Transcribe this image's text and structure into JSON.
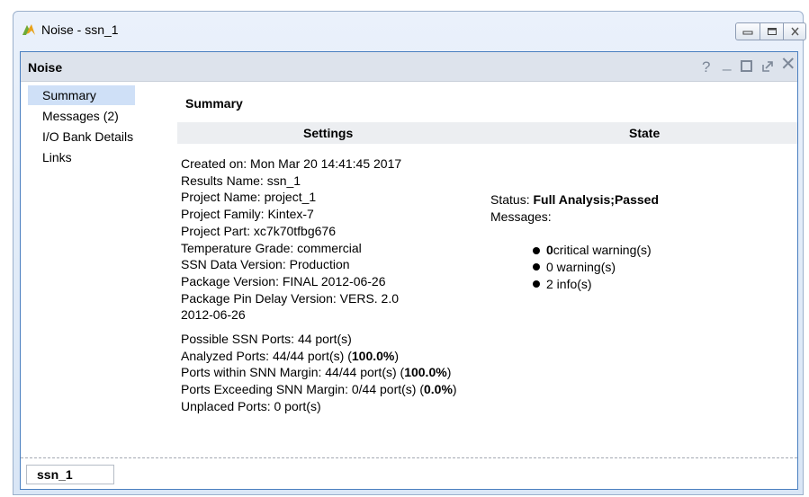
{
  "window": {
    "title": "Noise - ssn_1",
    "icon": "vivado-logo-icon",
    "controls": [
      "minimize",
      "maximize",
      "close"
    ]
  },
  "panel": {
    "title": "Noise",
    "header_controls": {
      "help": "?",
      "minimize": "_",
      "restore": "⇗",
      "close": "✕"
    }
  },
  "nav": {
    "items": [
      {
        "label": "Summary",
        "active": true
      },
      {
        "label": "Messages (2)",
        "active": false
      },
      {
        "label": "I/O Bank Details",
        "active": false
      },
      {
        "label": "Links",
        "active": false
      }
    ]
  },
  "content": {
    "title": "Summary",
    "settings_header": "Settings",
    "state_header": "State",
    "settings": {
      "created_on": "Created on: Mon Mar 20 14:41:45 2017",
      "results_name": "Results Name: ssn_1",
      "project_name": "Project Name: project_1",
      "project_family": "Project Family: Kintex-7",
      "project_part": "Project Part: xc7k70tfbg676",
      "temperature_grade": "Temperature Grade: commercial",
      "ssn_data_version": "SSN Data Version: Production",
      "package_version": "Package Version: FINAL 2012-06-26",
      "package_pin_delay_1": "Package Pin Delay Version: VERS. 2.0",
      "package_pin_delay_2": "2012-06-26"
    },
    "ports": {
      "possible": "Possible SSN Ports: 44 port(s)",
      "analyzed_text": "Analyzed Ports: 44/44 port(s) (",
      "analyzed_pct": "100.0%",
      "within_text": "Ports within SNN Margin: 44/44 port(s) (",
      "within_pct": "100.0%",
      "exceeding_text": "Ports Exceeding SNN Margin: 0/44 port(s) (",
      "exceeding_pct": "0.0%",
      "close_paren": ")",
      "unplaced": "Unplaced Ports: 0 port(s)"
    },
    "state": {
      "status_label": "Status: ",
      "status_value": "Full Analysis;Passed",
      "messages_label": "Messages:",
      "critical_count": "0",
      "critical_text": " critical warning(s)",
      "warnings": "0 warning(s)",
      "infos": "2 info(s)"
    }
  },
  "footer": {
    "tab_label": "ssn_1"
  },
  "colors": {
    "panel_border": "#4a7fc0",
    "header_bg": "#dde3ec",
    "nav_active": "#cfe0f7",
    "cols_header_bg": "#eceef1"
  }
}
